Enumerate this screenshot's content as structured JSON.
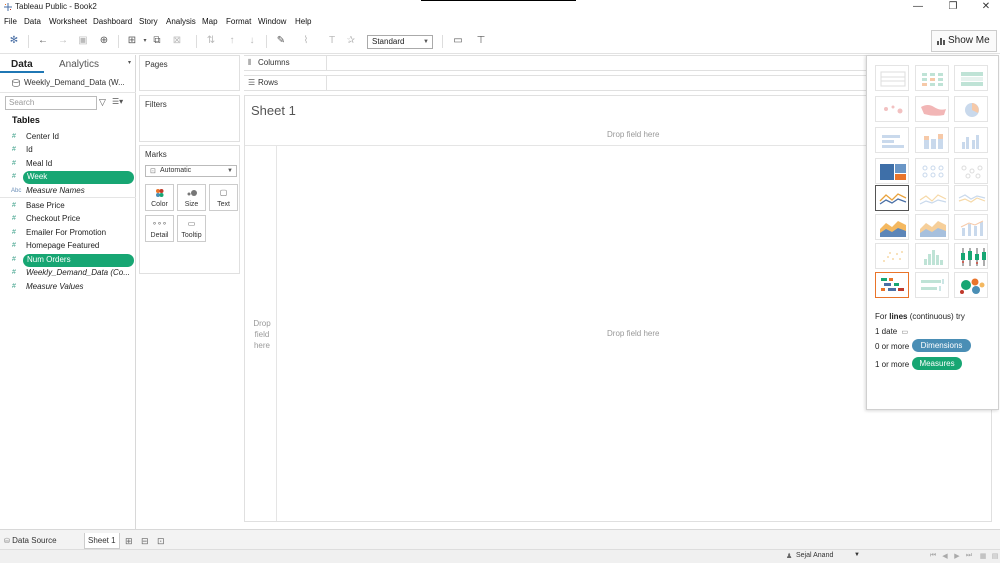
{
  "window": {
    "title": "Tableau Public - Book2",
    "minimize": "—",
    "restore": "❐",
    "close": "✕"
  },
  "menu": [
    "File",
    "Data",
    "Worksheet",
    "Dashboard",
    "Story",
    "Analysis",
    "Map",
    "Format",
    "Window",
    "Help"
  ],
  "toolbar": {
    "fit_value": "Standard",
    "show_me_label": "Show Me"
  },
  "data_pane": {
    "tab_data": "Data",
    "tab_analytics": "Analytics",
    "datasource": "Weekly_Demand_Data (W...",
    "search_placeholder": "Search",
    "tables_heading": "Tables",
    "fields": [
      {
        "type": "#",
        "label": "Center Id",
        "italic": false,
        "selected": false
      },
      {
        "type": "#",
        "label": "Id",
        "italic": false,
        "selected": false
      },
      {
        "type": "#",
        "label": "Meal Id",
        "italic": false,
        "selected": false
      },
      {
        "type": "#",
        "label": "Week",
        "italic": false,
        "selected": true
      },
      {
        "type": "Abc",
        "label": "Measure Names",
        "italic": true,
        "selected": false
      },
      {
        "type": "#",
        "label": "Base Price",
        "italic": false,
        "selected": false
      },
      {
        "type": "#",
        "label": "Checkout Price",
        "italic": false,
        "selected": false
      },
      {
        "type": "#",
        "label": "Emailer For Promotion",
        "italic": false,
        "selected": false
      },
      {
        "type": "#",
        "label": "Homepage Featured",
        "italic": false,
        "selected": false
      },
      {
        "type": "#",
        "label": "Num Orders",
        "italic": false,
        "selected": true
      },
      {
        "type": "#",
        "label": "Weekly_Demand_Data (Co...",
        "italic": true,
        "selected": false
      },
      {
        "type": "#",
        "label": "Measure Values",
        "italic": true,
        "selected": false
      }
    ]
  },
  "cards": {
    "pages": "Pages",
    "filters": "Filters",
    "marks": "Marks",
    "mark_type": "Automatic",
    "mark_buttons": [
      {
        "label": "Color",
        "icon": "color-icon"
      },
      {
        "label": "Size",
        "icon": "size-icon"
      },
      {
        "label": "Text",
        "icon": "text-icon"
      },
      {
        "label": "Detail",
        "icon": "detail-icon"
      },
      {
        "label": "Tooltip",
        "icon": "tooltip-icon"
      }
    ]
  },
  "shelves": {
    "columns": "Columns",
    "rows": "Rows"
  },
  "canvas": {
    "sheet_title": "Sheet 1",
    "drop_top": "Drop field here",
    "drop_main": "Drop field here",
    "drop_left": "Drop field here"
  },
  "show_me": {
    "hint_prefix": "For ",
    "hint_bold": "lines",
    "hint_suffix": " (continuous) try",
    "req_date": "1 date",
    "req_dims_prefix": "0 or more",
    "req_dims_pill": "Dimensions",
    "req_meas_prefix": "1 or more",
    "req_meas_pill": "Measures"
  },
  "bottom_tabs": {
    "data_source": "Data Source",
    "sheet": "Sheet 1"
  },
  "status": {
    "user": "Sejal Anand"
  },
  "colors": {
    "accent_green": "#17a673",
    "accent_blue": "#4a8eb5",
    "recommended_orange": "#e9742a"
  }
}
